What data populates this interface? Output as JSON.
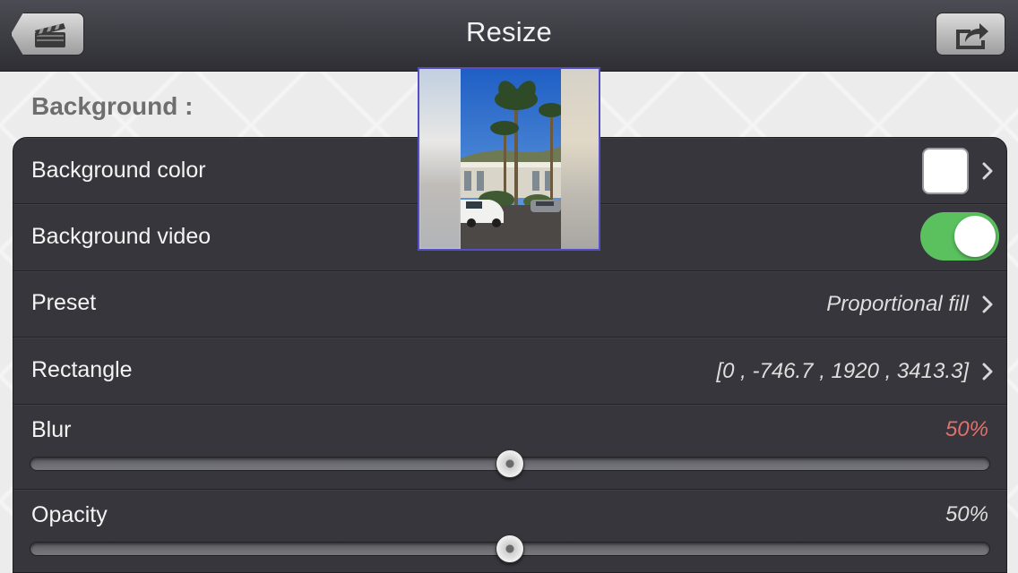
{
  "nav": {
    "title": "Resize",
    "back_icon": "clapperboard-icon",
    "share_icon": "share-icon"
  },
  "section": {
    "header": "Background :"
  },
  "rows": {
    "background_color": {
      "label": "Background color",
      "value_color": "#ffffff"
    },
    "background_video": {
      "label": "Background video",
      "enabled": true,
      "toggle_color": "#5ac15e"
    },
    "preset": {
      "label": "Preset",
      "value": "Proportional fill"
    },
    "rectangle": {
      "label": "Rectangle",
      "value": "[0 , -746.7 , 1920 , 3413.3]"
    },
    "blur": {
      "label": "Blur",
      "value_text": "50%",
      "value": 0.5,
      "value_color": "#e0706c"
    },
    "opacity": {
      "label": "Opacity",
      "value_text": "50%",
      "value": 0.5
    }
  },
  "colors": {
    "nav_bar": "#3a3a40",
    "panel": "#36363c",
    "thumbnail_border": "#5250c4"
  }
}
